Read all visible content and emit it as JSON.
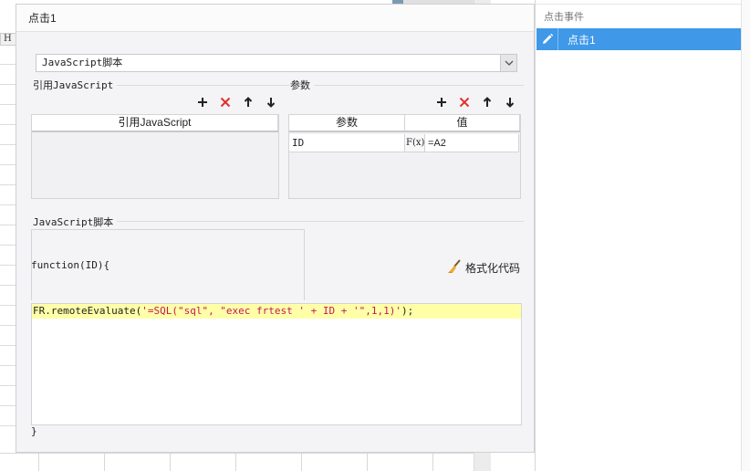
{
  "sheet": {
    "column_header": "H"
  },
  "dialog": {
    "title": "点击1",
    "script_type": {
      "selected": "JavaScript脚本"
    },
    "ref_section": {
      "label": "引用JavaScript",
      "column_header": "引用JavaScript"
    },
    "param_section": {
      "label": "参数",
      "columns": [
        "参数",
        "值"
      ],
      "rows": [
        {
          "name": "ID",
          "formula_icon": "F(x)",
          "value": "=A2"
        }
      ]
    },
    "toolbar_icons": [
      "plus-icon",
      "delete-x-icon",
      "arrow-up-icon",
      "arrow-down-icon"
    ],
    "script_section": {
      "label": "JavaScript脚本",
      "function_header": "function(ID){",
      "format_button": "格式化代码",
      "code_prefix": "FR.remoteEvaluate(",
      "code_string": "'=SQL(\"sql\", \"exec frtest ' + ID + '\",1,1)'",
      "code_suffix": ");",
      "closing_brace": "}"
    }
  },
  "right_panel": {
    "title": "点击事件",
    "items": [
      {
        "label": "点击1",
        "selected": true
      }
    ]
  },
  "colors": {
    "accent": "#3f98e8",
    "delete": "#e0302a",
    "code_highlight": "#ffffa8",
    "code_string": "#c2185b"
  }
}
